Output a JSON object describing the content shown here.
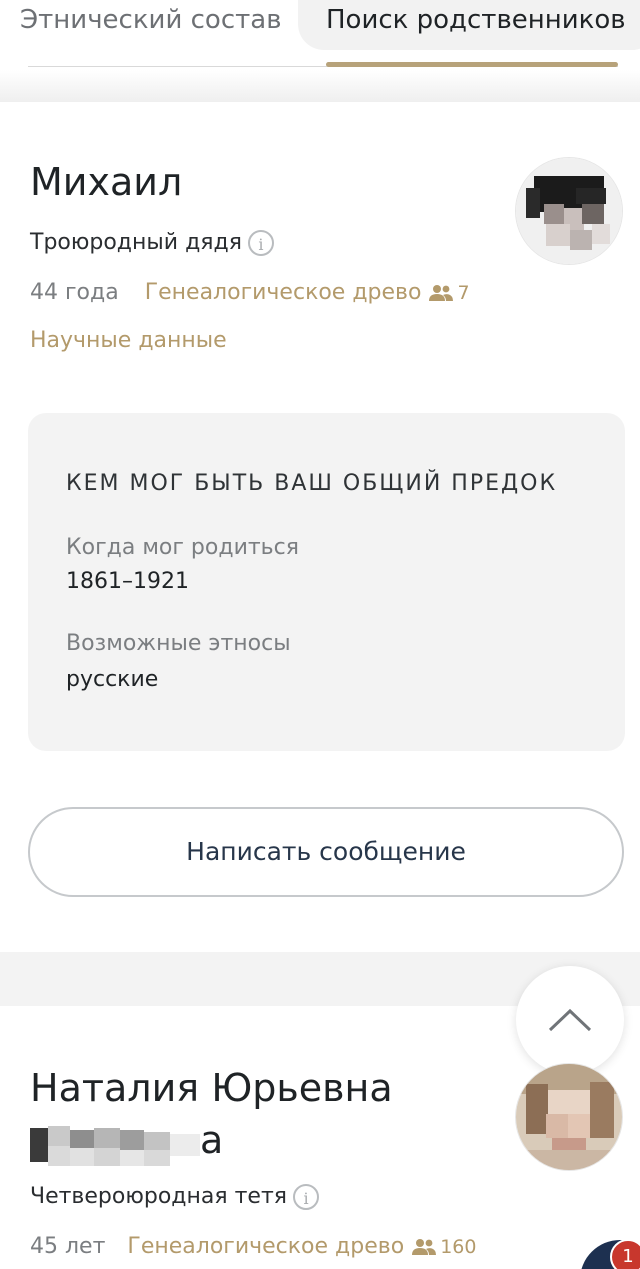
{
  "tabs": {
    "ethnic_label": "Этнический состав",
    "search_label": "Поиск родственников",
    "active_color": "#b7a27a"
  },
  "card1": {
    "name": "Михаил",
    "relation": "Троюродный дядя",
    "age": "44 года",
    "tree_link": "Генеалогическое древо",
    "tree_count": "7",
    "science_link": "Научные данные",
    "ancestor": {
      "title": "КЕМ МОГ БЫТЬ ВАШ ОБЩИЙ ПРЕДОК",
      "born_label": "Когда мог родиться",
      "born_value": "1861–1921",
      "ethnos_label": "Возможные этносы",
      "ethnos_value": "русские"
    },
    "message_button": "Написать сообщение"
  },
  "card2": {
    "name_line1": "Наталия Юрьевна",
    "name_line2_tail": "а",
    "relation": "Четвероюродная тетя",
    "age": "45 лет",
    "tree_link": "Генеалогическое древо",
    "tree_count": "160"
  },
  "notification": {
    "badge_count": "1"
  },
  "colors": {
    "accent_gold": "#b39a6b",
    "button_text": "#27364a",
    "badge_red": "#c8372d"
  },
  "icons": [
    "info-icon",
    "people-icon",
    "chevron-up-icon"
  ]
}
